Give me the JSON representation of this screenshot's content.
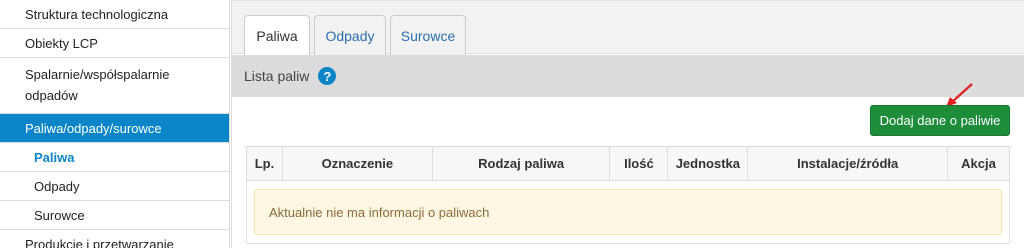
{
  "sidebar": {
    "items": [
      {
        "label": "Struktura technologiczna"
      },
      {
        "label": "Obiekty LCP"
      },
      {
        "label": "Spalarnie/współspalarnie odpadów"
      },
      {
        "label": "Paliwa/odpady/surowce"
      },
      {
        "label": "Paliwa"
      },
      {
        "label": "Odpady"
      },
      {
        "label": "Surowce"
      },
      {
        "label": "Produkcje i przetwarzanie"
      }
    ]
  },
  "tabs": [
    {
      "label": "Paliwa"
    },
    {
      "label": "Odpady"
    },
    {
      "label": "Surowce"
    }
  ],
  "section": {
    "title": "Lista paliw",
    "help_icon": "?"
  },
  "actions": {
    "add_label": "Dodaj dane o paliwie"
  },
  "table": {
    "headers": [
      "Lp.",
      "Oznaczenie",
      "Rodzaj paliwa",
      "Ilość",
      "Jednostka",
      "Instalacje/źródła",
      "Akcja"
    ],
    "empty_message": "Aktualnie nie ma informacji o paliwach"
  },
  "colors": {
    "accent": "#0a86c8",
    "button_green": "#1e8d3a",
    "arrow_red": "#e02020"
  }
}
